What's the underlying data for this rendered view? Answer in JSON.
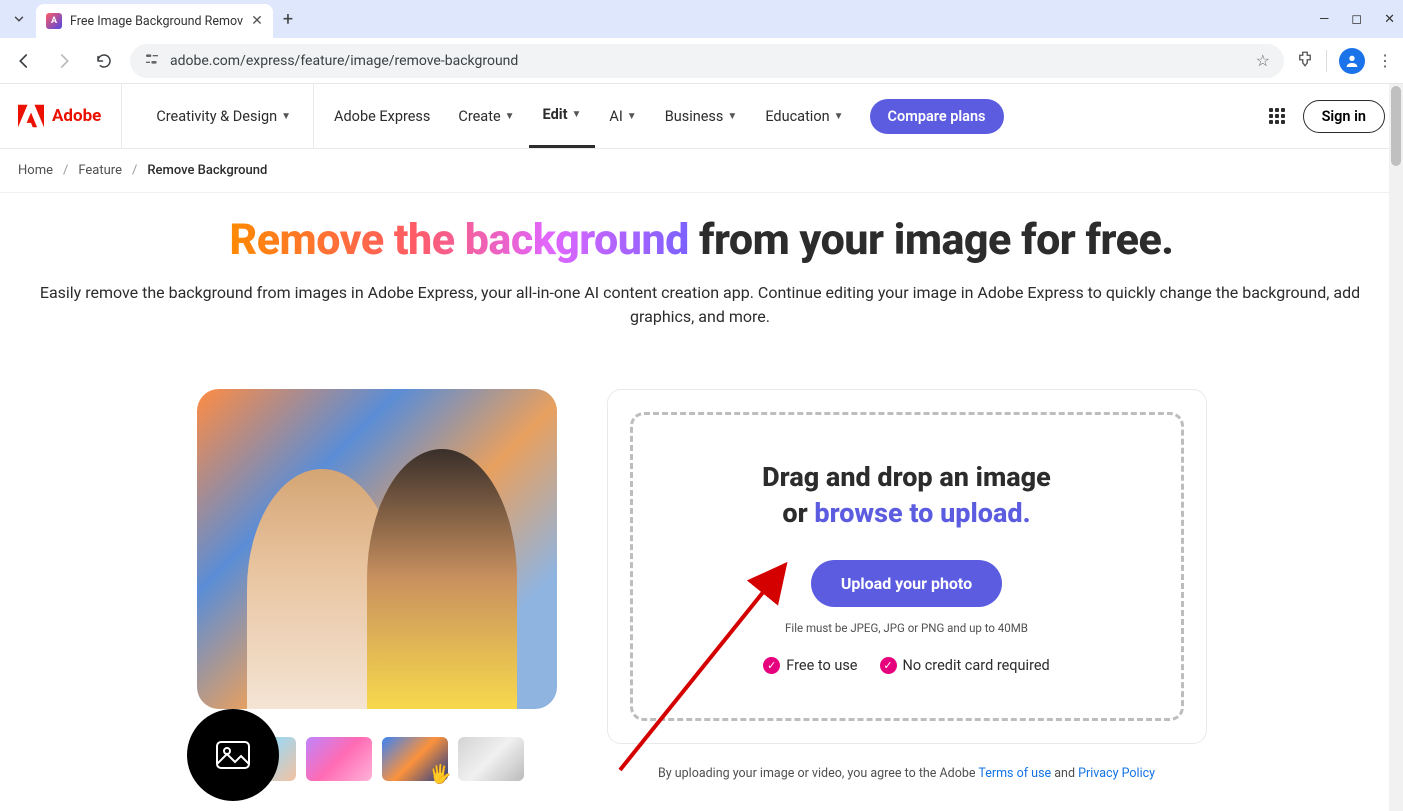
{
  "browser": {
    "tab_title": "Free Image Background Remov",
    "url": "adobe.com/express/feature/image/remove-background"
  },
  "nav": {
    "brand": "Adobe",
    "items": [
      "Creativity & Design",
      "Adobe Express",
      "Create",
      "Edit",
      "AI",
      "Business",
      "Education"
    ],
    "cta": "Compare plans",
    "signin": "Sign in"
  },
  "breadcrumbs": [
    "Home",
    "Feature",
    "Remove Background"
  ],
  "hero": {
    "title_gradient": "Remove the background",
    "title_rest": " from your image for free.",
    "subtitle": "Easily remove the background from images in Adobe Express, your all-in-one AI content creation app. Continue editing your image in Adobe Express to quickly change the background, add graphics, and more."
  },
  "dropzone": {
    "line1": "Drag and drop an image",
    "or": "or ",
    "browse": "browse to upload.",
    "button": "Upload your photo",
    "file_note": "File must be JPEG, JPG or PNG and up to 40MB",
    "badge1": "Free to use",
    "badge2": "No credit card required"
  },
  "legal": {
    "prefix": "By uploading your image or video, you agree to the Adobe ",
    "terms": "Terms of use",
    "and": " and ",
    "privacy": "Privacy Policy"
  }
}
